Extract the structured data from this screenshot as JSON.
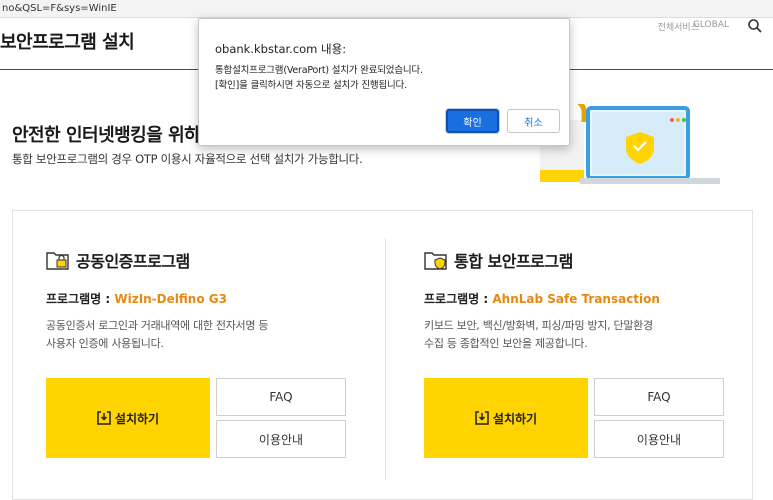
{
  "browser": {
    "url": "no&QSL=F&sys=WinIE"
  },
  "header": {
    "title": "보안프로그램 설치",
    "link1": "전체서비스",
    "global_label": "GLOBAL",
    "search_icon": "search-icon"
  },
  "hero": {
    "title": "안전한 인터넷뱅킹을 위하",
    "subtitle": "통합 보안프로그램의 경우 OTP 이용시 자율적으로 선택 설치가 가능합니다."
  },
  "columns": [
    {
      "title": "공동인증프로그램",
      "icon": "folder-lock-icon",
      "prog_label": "프로그램명 : ",
      "prog_name": "WizIn-Delfino G3",
      "desc_line1": "공동인증서 로그인과 거래내역에 대한 전자서명 등",
      "desc_line2": "사용자 인증에 사용됩니다.",
      "install": "설치하기",
      "faq": "FAQ",
      "guide": "이용안내"
    },
    {
      "title": "통합 보안프로그램",
      "icon": "folder-shield-icon",
      "prog_label": "프로그램명 : ",
      "prog_name": "AhnLab Safe Transaction",
      "desc_line1": "키보드 보안, 백신/방화벽, 피싱/파밍 방지, 단말환경",
      "desc_line2": "수집 등 종합적인 보안을 제공합니다.",
      "install": "설치하기",
      "faq": "FAQ",
      "guide": "이용안내"
    }
  ],
  "dialog": {
    "host": "obank.kbstar.com 내용:",
    "line1": "통합설치프로그램(VeraPort) 설치가 완료되었습니다.",
    "line2": "[확인]을 클릭하시면 자동으로 설치가 진행됩니다.",
    "ok": "확인",
    "cancel": "취소"
  },
  "colors": {
    "accent": "#ffd400",
    "program_name": "#e8890f",
    "dialog_ok": "#1a6fe0"
  }
}
